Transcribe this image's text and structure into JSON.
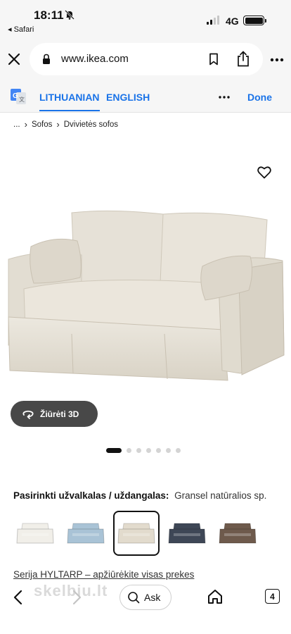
{
  "status_bar": {
    "time": "18:11",
    "back_app": "◂ Safari",
    "network": "4G"
  },
  "browser": {
    "url": "www.ikea.com"
  },
  "translate_bar": {
    "languages": [
      "LITHUANIAN",
      "ENGLISH"
    ],
    "active_language": "LITHUANIAN",
    "done_label": "Done"
  },
  "breadcrumb": {
    "items": [
      "...",
      "Sofos",
      "Dvivietės sofos"
    ]
  },
  "product": {
    "view_3d_label": "Žiūrėti 3D",
    "image_count": 7,
    "active_image": 1,
    "cover_label": "Pasirinkti užvalkalas / uždangalas:",
    "cover_value": "Gransel natūralios sp.",
    "swatches": [
      {
        "color": "#f1efe9",
        "name": "white"
      },
      {
        "color": "#a9c3d6",
        "name": "light-blue"
      },
      {
        "color": "#e2dbcd",
        "name": "natural"
      },
      {
        "color": "#3e4756",
        "name": "dark-blue"
      },
      {
        "color": "#6e5a4c",
        "name": "brown"
      }
    ],
    "selected_swatch": 2,
    "series_link": "Serija HYLTARP – apžiūrėkite visas prekes"
  },
  "bottom_bar": {
    "ask_label": "Ask",
    "tab_count": "4",
    "watermark": "skelbiu.lt"
  },
  "colors": {
    "link_blue": "#1a73e8",
    "sofa": "#e6e1d6",
    "button_dark": "#484848"
  }
}
